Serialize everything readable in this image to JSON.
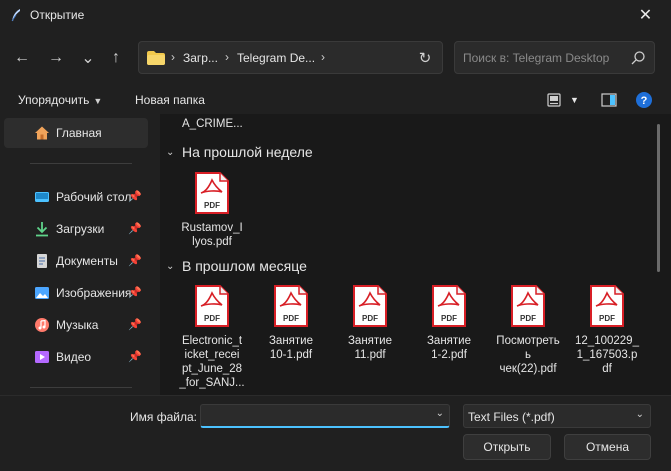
{
  "window": {
    "title": "Открытие",
    "close_glyph": "✕"
  },
  "nav": {
    "back_glyph": "←",
    "forward_glyph": "→",
    "recent_glyph": "⌄",
    "up_glyph": "↑",
    "chevron_glyph": "›",
    "breadcrumbs": [
      "Загр...",
      "Telegram De..."
    ],
    "refresh_glyph": "↻"
  },
  "search": {
    "placeholder": "Поиск в: Telegram Desktop"
  },
  "toolbar": {
    "organize_label": "Упорядочить",
    "caret_glyph": "▼",
    "new_folder_label": "Новая папка"
  },
  "sidebar": {
    "home_label": "Главная",
    "pin_glyph": "📌",
    "items": [
      {
        "label": "Рабочий стол",
        "icon": "desktop-icon",
        "color": "#4cc2ff"
      },
      {
        "label": "Загрузки",
        "icon": "downloads-icon",
        "color": "#5fd38a"
      },
      {
        "label": "Документы",
        "icon": "documents-icon",
        "color": "#c8c8c8"
      },
      {
        "label": "Изображения",
        "icon": "pictures-icon",
        "color": "#4ca6ff"
      },
      {
        "label": "Музыка",
        "icon": "music-icon",
        "color": "#ff7a6b"
      },
      {
        "label": "Видео",
        "icon": "videos-icon",
        "color": "#b469ff"
      }
    ]
  },
  "content": {
    "partial_file_name": "A_CRIME...",
    "chevron_glyph": "⌄",
    "groups": [
      {
        "header": "На прошлой неделе",
        "files": [
          {
            "name": "Rustamov_I\nlyos.pdf"
          }
        ]
      },
      {
        "header": "В прошлом месяце",
        "files": [
          {
            "name": "Electronic_t\nicket_recei\npt_June_28\n_for_SANJ..."
          },
          {
            "name": "Занятие\n10-1.pdf"
          },
          {
            "name": "Занятие\n11.pdf"
          },
          {
            "name": "Занятие\n1-2.pdf"
          },
          {
            "name": "Посмотреть\nь\nчек(22).pdf"
          },
          {
            "name": "12_100229_\n1_167503.p\ndf"
          }
        ]
      }
    ],
    "pdf_label": "PDF"
  },
  "bottom": {
    "file_name_label": "Имя файла:",
    "file_name_value": "",
    "dropdown_glyph": "⌄",
    "file_type_value": "Text Files (*.pdf)",
    "open_label": "Открыть",
    "cancel_label": "Отмена"
  },
  "colors": {
    "accent": "#4cc2ff",
    "pdf_red": "#d81f26",
    "folder_yellow": "#f2c94c",
    "help_blue": "#1e6fd9"
  }
}
